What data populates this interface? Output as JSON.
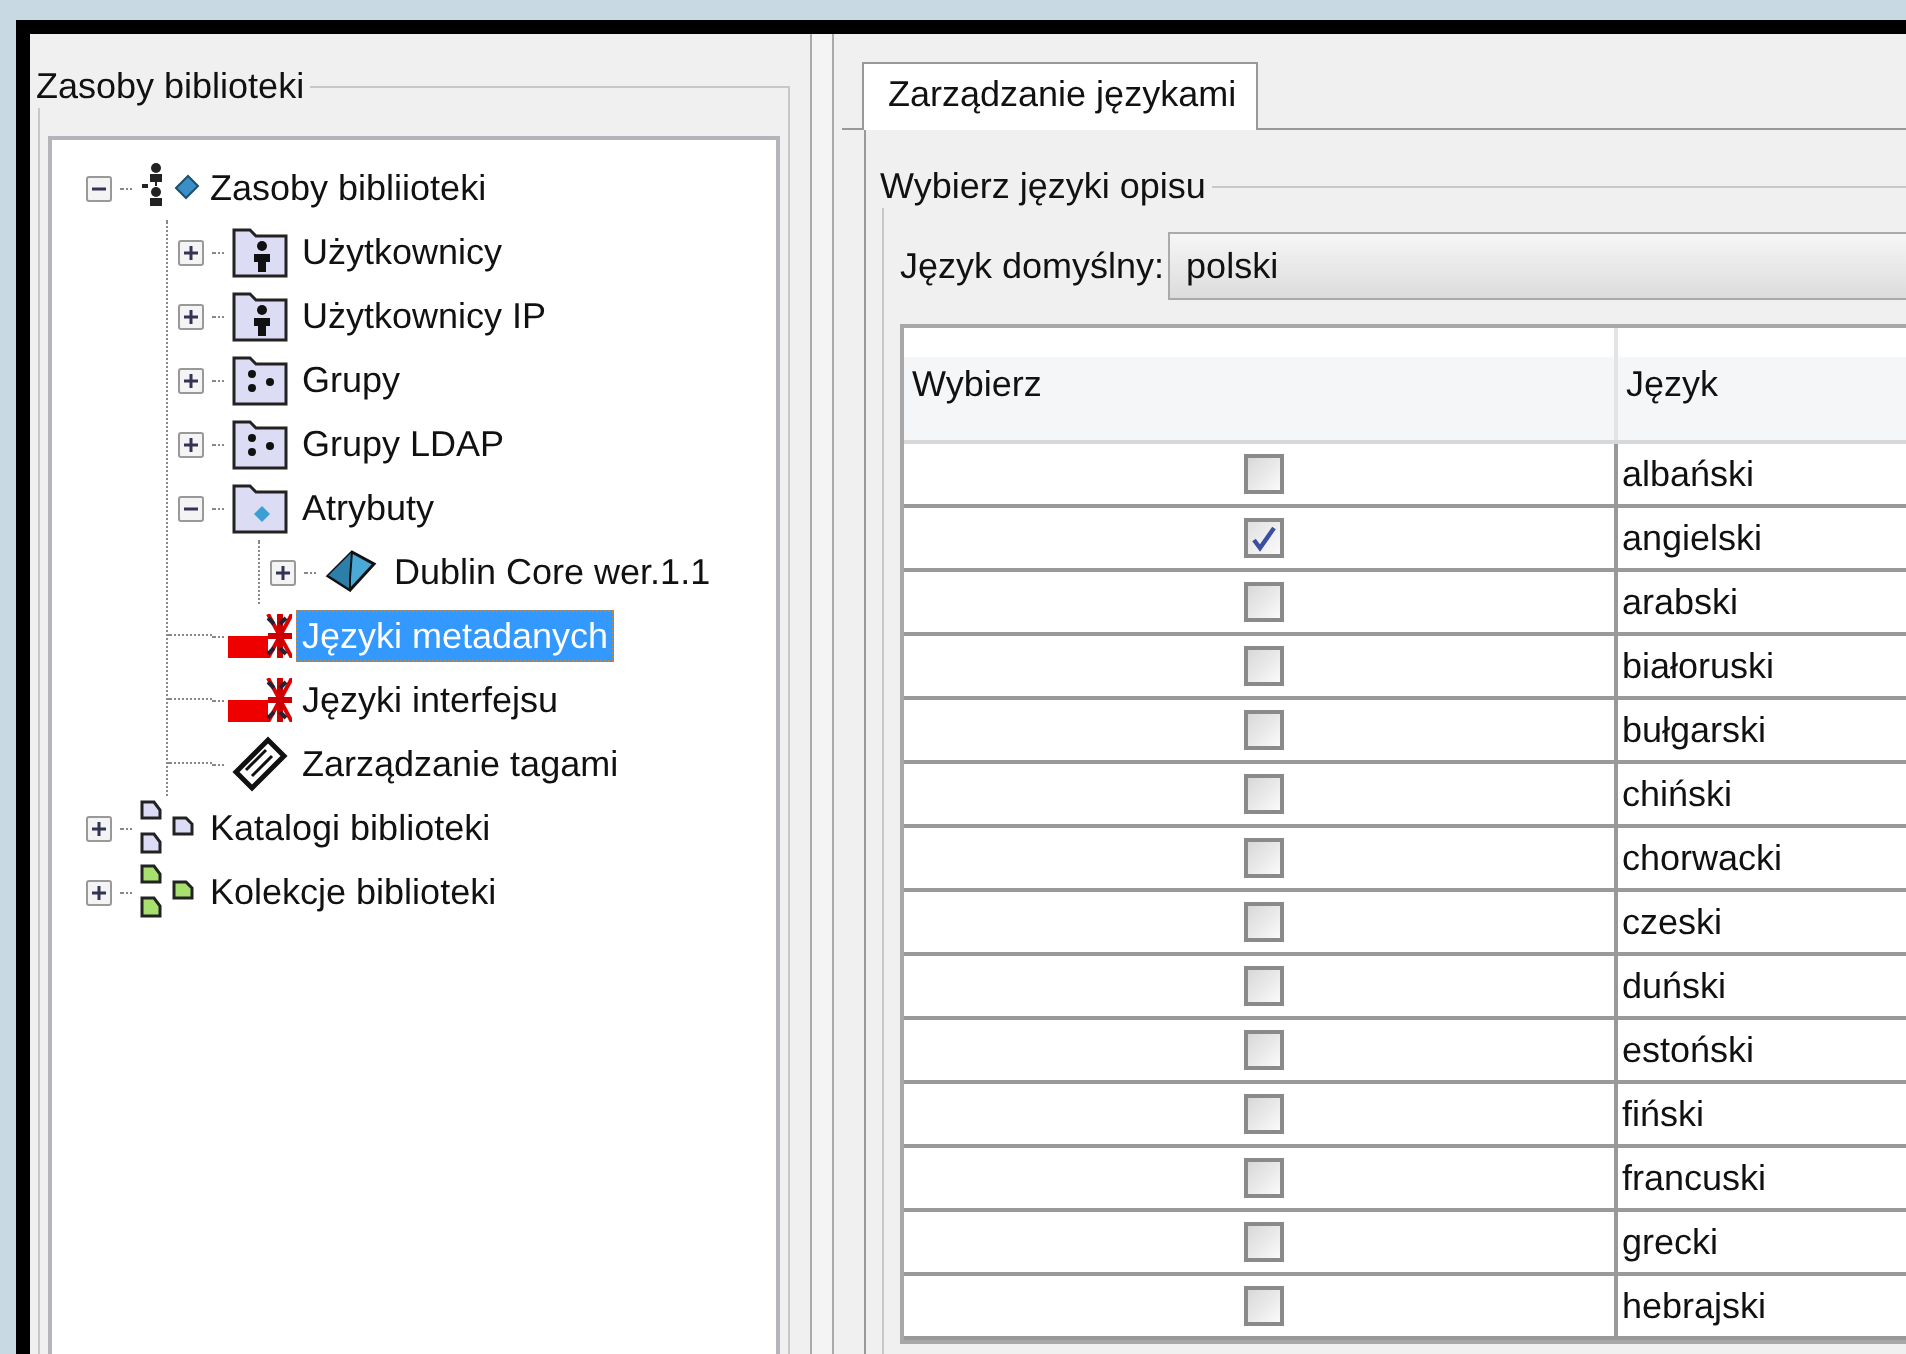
{
  "left_panel": {
    "group_title": "Zasoby biblioteki",
    "tree": [
      {
        "label": "Zasoby bibliioteki",
        "kind": "root",
        "expanded": true,
        "selected": false,
        "children": [
          {
            "label": "Użytkownicy",
            "kind": "users",
            "expanded": false,
            "selected": false
          },
          {
            "label": "Użytkownicy IP",
            "kind": "users",
            "expanded": false,
            "selected": false
          },
          {
            "label": "Grupy",
            "kind": "groups",
            "expanded": false,
            "selected": false
          },
          {
            "label": "Grupy LDAP",
            "kind": "groups",
            "expanded": false,
            "selected": false
          },
          {
            "label": "Atrybuty",
            "kind": "attributes",
            "expanded": true,
            "selected": false,
            "children": [
              {
                "label": "Dublin Core wer.1.1",
                "kind": "schema",
                "expanded": false,
                "selected": false
              }
            ]
          },
          {
            "label": "Języki metadanych",
            "kind": "flag",
            "selected": true
          },
          {
            "label": "Języki interfejsu",
            "kind": "flag",
            "selected": false
          },
          {
            "label": "Zarządzanie tagami",
            "kind": "tag",
            "selected": false
          }
        ]
      },
      {
        "label": "Katalogi biblioteki",
        "kind": "catalogs",
        "expanded": false,
        "selected": false
      },
      {
        "label": "Kolekcje biblioteki",
        "kind": "collections",
        "expanded": false,
        "selected": false
      }
    ]
  },
  "right_panel": {
    "tabs": [
      {
        "label": "Zarządzanie językami",
        "selected": true
      }
    ],
    "group_title": "Wybierz języki opisu",
    "default_language": {
      "label": "Język domyślny:",
      "value": "polski"
    },
    "table": {
      "columns": [
        "Wybierz",
        "Język"
      ],
      "rows": [
        {
          "checked": false,
          "language": "albański"
        },
        {
          "checked": true,
          "language": "angielski"
        },
        {
          "checked": false,
          "language": "arabski"
        },
        {
          "checked": false,
          "language": "białoruski"
        },
        {
          "checked": false,
          "language": "bułgarski"
        },
        {
          "checked": false,
          "language": "chiński"
        },
        {
          "checked": false,
          "language": "chorwacki"
        },
        {
          "checked": false,
          "language": "czeski"
        },
        {
          "checked": false,
          "language": "duński"
        },
        {
          "checked": false,
          "language": "estoński"
        },
        {
          "checked": false,
          "language": "fiński"
        },
        {
          "checked": false,
          "language": "francuski"
        },
        {
          "checked": false,
          "language": "grecki"
        },
        {
          "checked": false,
          "language": "hebrajski"
        }
      ]
    }
  }
}
